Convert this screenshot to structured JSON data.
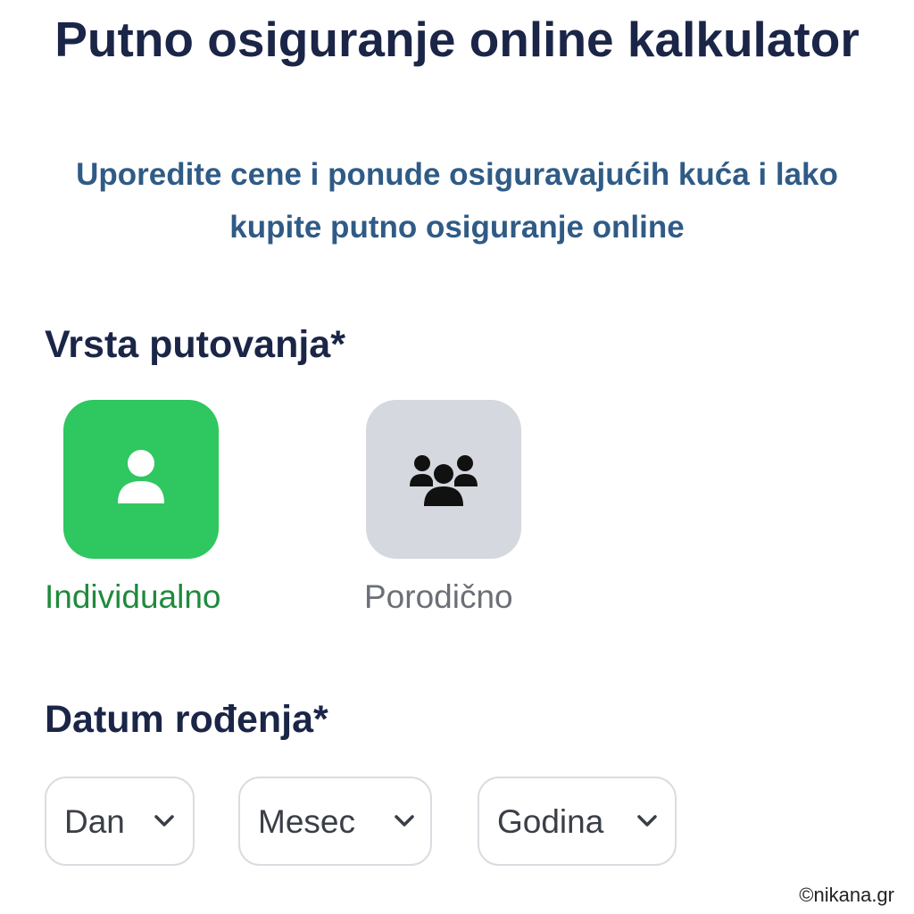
{
  "header": {
    "title": "Putno osiguranje online kalkulator",
    "subtitle_line1": "Uporedite cene i ponude osiguravajućih kuća i lako",
    "subtitle_line2": "kupite putno osiguranje online"
  },
  "trip_type": {
    "heading": "Vrsta putovanja*",
    "options": [
      {
        "label": "Individualno",
        "icon": "person-icon",
        "selected": true
      },
      {
        "label": "Porodično",
        "icon": "group-icon",
        "selected": false
      }
    ]
  },
  "birth_date": {
    "heading": "Datum rođenja*",
    "day_label": "Dan",
    "month_label": "Mesec",
    "year_label": "Godina"
  },
  "colors": {
    "title": "#1b2547",
    "subtitle": "#2f5b86",
    "selected_tile": "#2fc75f",
    "selected_label": "#1f8a3c",
    "unselected_tile": "#d5d8de",
    "unselected_label": "#6b7077"
  },
  "watermark": "©nikana.gr"
}
